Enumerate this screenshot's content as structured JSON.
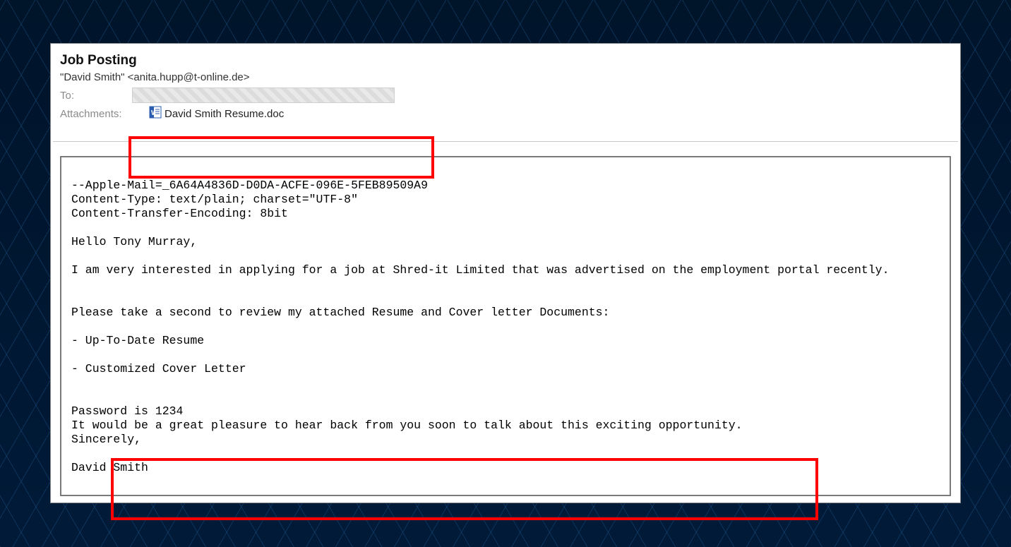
{
  "header": {
    "subject": "Job Posting",
    "from": "\"David Smith\" <anita.hupp@t-online.de>",
    "to_label": "To:",
    "attachments_label": "Attachments:",
    "attachment_name": "David Smith Resume.doc"
  },
  "body": {
    "line_boundary": "--Apple-Mail=_6A64A4836D-D0DA-ACFE-096E-5FEB89509A9",
    "line_ct": "Content-Type: text/plain; charset=\"UTF-8\"",
    "line_cte": "Content-Transfer-Encoding: 8bit",
    "greeting": "Hello Tony Murray,",
    "p1": "I am very interested in applying for a job at Shred-it Limited that was advertised on the employment portal recently.",
    "p2": "Please take a second to review my attached Resume and Cover letter Documents:",
    "bullet1": "- Up-To-Date Resume",
    "bullet2": "- Customized Cover Letter",
    "password": "Password is 1234",
    "p3": "It would be a great pleasure to hear back from you soon to talk about this exciting opportunity.",
    "closing": "Sincerely,",
    "signature": "David Smith"
  }
}
